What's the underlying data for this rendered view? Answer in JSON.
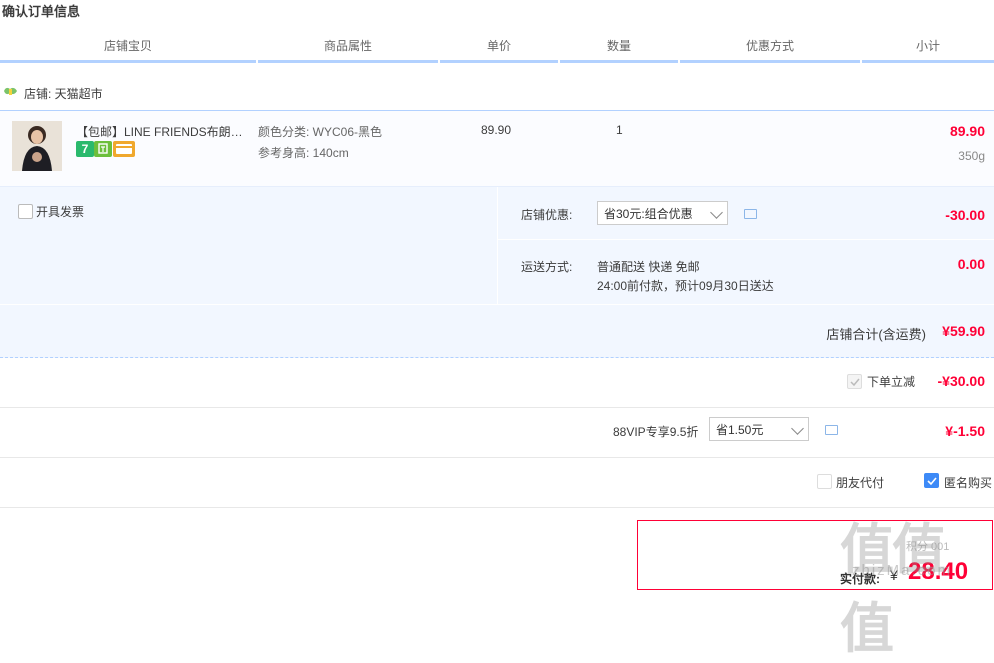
{
  "page": {
    "title": "确认订单信息"
  },
  "columns": [
    "店铺宝贝",
    "商品属性",
    "单价",
    "数量",
    "优惠方式",
    "小计"
  ],
  "shop": {
    "label": "店铺: 天猫超市",
    "icon": "shop-leaf-icon",
    "icon_color": "#7cc36a"
  },
  "item": {
    "title": "【包邮】LINE FRIENDS布朗…",
    "attr_color": "颜色分类: WYC06-黑色",
    "attr_height": "参考身高: 140cm",
    "price": "89.90",
    "quantity": "1",
    "subtotal": "89.90",
    "weight": "350g",
    "badges": [
      {
        "text": "7",
        "color": "#2ab96d"
      },
      {
        "text": "",
        "color": "#6cbf3c"
      },
      {
        "text": "",
        "color": "#f0a82d"
      }
    ]
  },
  "invoice": {
    "label": "开具发票"
  },
  "shop_discount": {
    "label": "店铺优惠:",
    "selected": "省30元:组合优惠",
    "amount": "-30.00"
  },
  "shipping": {
    "label": "运送方式:",
    "method": "普通配送 快递 免邮",
    "note": "24:00前付款，预计09月30日送达",
    "amount": "0.00"
  },
  "shop_total": {
    "label": "店铺合计(含运费)",
    "amount": "¥59.90"
  },
  "instant_discount": {
    "label": "下单立减",
    "amount": "-¥30.00"
  },
  "vip": {
    "label": "88VIP专享9.5折",
    "selected": "省1.50元",
    "amount": "¥-1.50"
  },
  "options": {
    "friend_pay": "朋友代付",
    "anonymous": "匿名购买"
  },
  "pay": {
    "label": "实付款:",
    "currency": "¥",
    "amount": "28.40",
    "faded_text": "积分 001"
  },
  "watermark": {
    "text": "值值值",
    "url": "zhizMa.com"
  },
  "colors": {
    "accent_red": "#ff0036",
    "accent_blue": "#b2d1ff",
    "panel_bg": "#f2f7ff"
  }
}
